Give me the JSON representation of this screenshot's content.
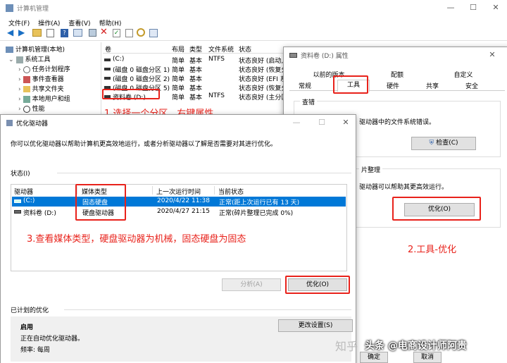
{
  "cm": {
    "title": "计算机管理",
    "menu": [
      "文件(F)",
      "操作(A)",
      "查看(V)",
      "帮助(H)"
    ],
    "tree": [
      "计算机管理(本地)",
      "系统工具",
      "任务计划程序",
      "事件查看器",
      "共享文件夹",
      "本地用户和组",
      "性能"
    ],
    "cols": [
      "卷",
      "布局",
      "类型",
      "文件系统",
      "状态"
    ],
    "rows": [
      {
        "vol": "(C:)",
        "layout": "简单",
        "type": "基本",
        "fs": "NTFS",
        "status": "状态良好 (启动,"
      },
      {
        "vol": "(磁盘 0 磁盘分区 1)",
        "layout": "简单",
        "type": "基本",
        "fs": "",
        "status": "状态良好 (恢复分"
      },
      {
        "vol": "(磁盘 0 磁盘分区 2)",
        "layout": "简单",
        "type": "基本",
        "fs": "",
        "status": "状态良好 (EFI 系"
      },
      {
        "vol": "(磁盘 0 磁盘分区 5)",
        "layout": "简单",
        "type": "基本",
        "fs": "",
        "status": "状态良好 (恢复分"
      },
      {
        "vol": "资料卷 (D:)",
        "layout": "简单",
        "type": "基本",
        "fs": "NTFS",
        "status": "状态良好 (主分区"
      }
    ]
  },
  "props": {
    "title": "资料卷 (D:) 属性",
    "tabs_top": [
      "以前的版本",
      "配额",
      "自定义"
    ],
    "tabs_bottom": [
      "常规",
      "工具",
      "硬件",
      "共享",
      "安全"
    ],
    "check_group": "查错",
    "check_text": "驱动器中的文件系统错误。",
    "check_button": "检查(C)",
    "defrag_group": "片整理",
    "defrag_text": "驱动器可以帮助其更高效运行。",
    "optimize_button": "优化(O)",
    "ok_button": "确定",
    "cancel_button": "取消"
  },
  "opt": {
    "title": "优化驱动器",
    "desc": "你可以优化驱动器以帮助计算机更高效地运行，或者分析驱动器以了解是否需要对其进行优化。",
    "status_label": "状态(I)",
    "cols": [
      "驱动器",
      "媒体类型",
      "上一次运行时间",
      "当前状态"
    ],
    "rows": [
      {
        "drive": "(C:)",
        "media": "固态硬盘",
        "last": "2020/4/22 11:38",
        "status": "正常(距上次运行已有 13 天)"
      },
      {
        "drive": "资料卷 (D:)",
        "media": "硬盘驱动器",
        "last": "2020/4/27 21:15",
        "status": "正常(碎片整理已完成 0%)"
      }
    ],
    "analyze_button": "分析(A)",
    "optimize_button": "优化(O)",
    "scheduled_label": "已计划的优化",
    "enabled": "启用",
    "auto_text": "正在自动优化驱动器。",
    "freq": "频率: 每周",
    "change_button": "更改设置(S)"
  },
  "annotations": {
    "a1": "1.选择一个分区，右键属性",
    "a2": "2.工具-优化",
    "a3": "3.查看媒体类型，硬盘驱动器为机械，固态硬盘为固态"
  },
  "watermark": {
    "zhihu": "知乎",
    "toutiao": "头条 @电商设计师阿贵"
  },
  "colors": {
    "red": "#e8221b",
    "selected_row": "#0078d7"
  }
}
